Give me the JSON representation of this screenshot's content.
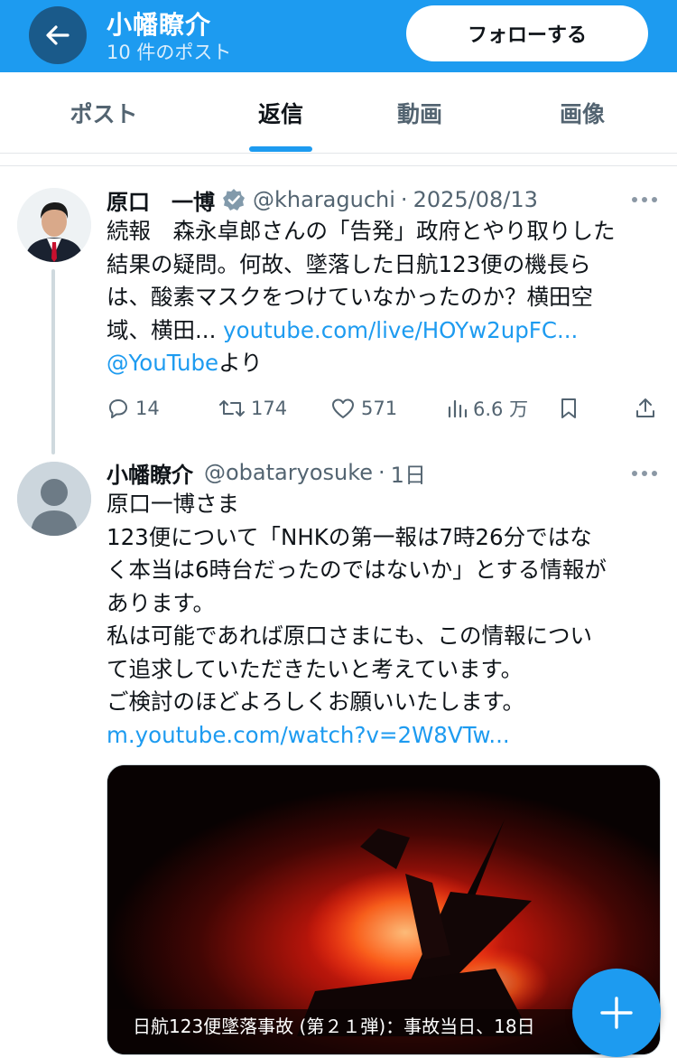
{
  "header": {
    "title": "小幡瞭介",
    "subtitle": "10 件のポスト",
    "follow_label": "フォローする",
    "accent_color": "#1d9bf0"
  },
  "tabs": [
    {
      "label": "ポスト",
      "active": false
    },
    {
      "label": "返信",
      "active": true
    },
    {
      "label": "動画",
      "active": false
    },
    {
      "label": "画像",
      "active": false
    }
  ],
  "tweet1": {
    "name": "原口　一博",
    "verified_icon": "verified-badge-icon",
    "handle": "@kharaguchi",
    "date": "2025/08/13",
    "lines": [
      "続報　森永卓郎さんの「告発」政府とやり取りした",
      "結果の疑問。何故、墜落した日航123便の機長ら",
      "は、酸素マスクをつけていなかったのか？横田空",
      "域、横田... "
    ],
    "link": "youtube.com/live/HOYw2upFC...",
    "mention": "@YouTube",
    "mention_suffix": "より",
    "actions": {
      "replies": "14",
      "reposts": "174",
      "likes": "571",
      "views": "6.6 万"
    }
  },
  "tweet2": {
    "name": "小幡瞭介",
    "handle": "@obataryosuke",
    "date": "1日",
    "lines": [
      "原口一博さま",
      "123便について「NHKの第一報は7時26分ではな",
      "く本当は6時台だったのではないか」とする情報が",
      "あります。",
      "私は可能であれば原口さまにも、この情報につい",
      "て追求していただきたいと考えています。",
      "ご検討のほどよろしくお願いいたします。"
    ],
    "link": "m.youtube.com/watch?v=2W8VTw...",
    "media_caption": "日航123便墜落事故 (第２１弾)：事故当日、18日"
  },
  "fab_icon": "plus-icon"
}
